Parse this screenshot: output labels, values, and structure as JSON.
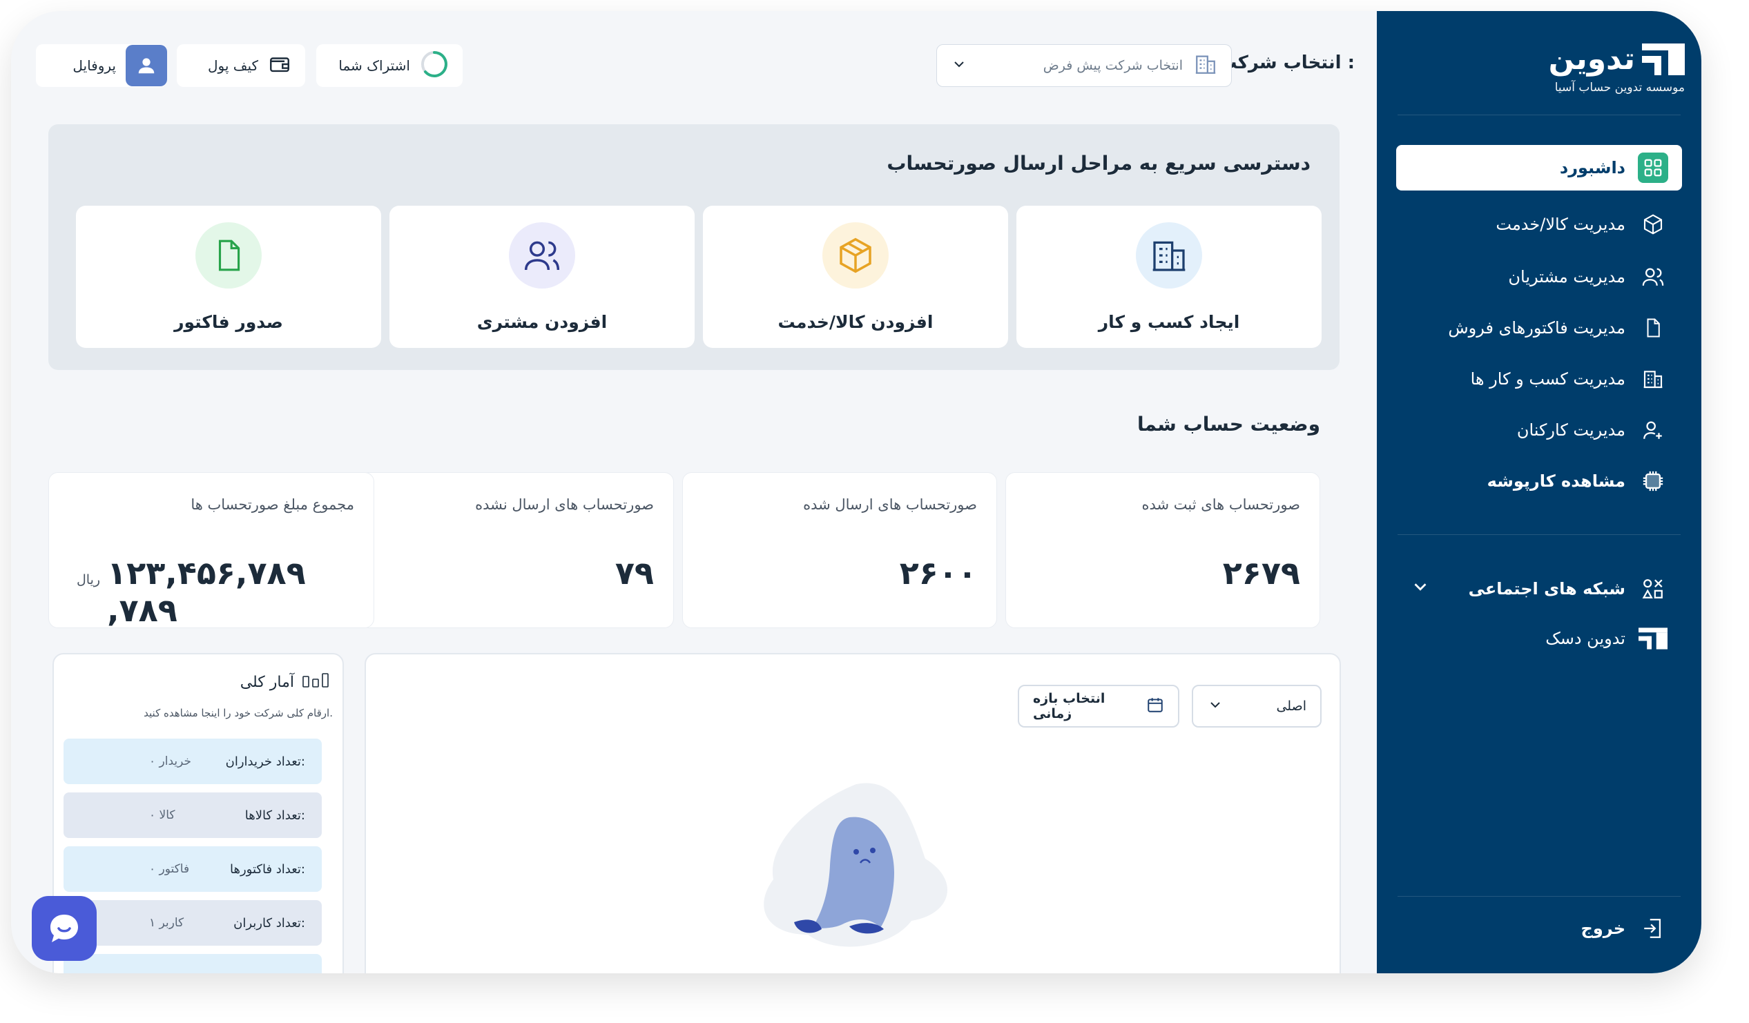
{
  "brand": {
    "name": "تدوین",
    "subtitle": "موسسه تدوین حساب آسیا"
  },
  "sidebar": {
    "items": [
      {
        "label": "داشبورد",
        "icon": "grid-icon"
      },
      {
        "label": "مدیریت کالا/خدمت",
        "icon": "box-icon"
      },
      {
        "label": "مدیریت مشتریان",
        "icon": "users-icon"
      },
      {
        "label": "مدیریت فاکتورهای فروش",
        "icon": "document-icon"
      },
      {
        "label": "مدیریت کسب و کار ها",
        "icon": "building-icon"
      },
      {
        "label": "مدیریت کارکنان",
        "icon": "user-plus-icon"
      },
      {
        "label": "مشاهده کارپوشه",
        "icon": "chip-icon"
      },
      {
        "label": "شبکه های اجتماعی",
        "icon": "shapes-icon"
      },
      {
        "label": "تدوین دسک",
        "icon": "tadvin-desk-icon"
      }
    ],
    "logout": "خروج"
  },
  "topbar": {
    "company_label": "انتخاب شرکت :",
    "company_placeholder": "انتخاب شرکت پیش فرض",
    "subscription": "اشتراک شما",
    "wallet": "کیف پول",
    "profile": "پروفایل"
  },
  "quick": {
    "title": "دسترسی سریع به مراحل ارسال صورتحساب",
    "cards": [
      {
        "label": "ایجاد کسب و کار",
        "icon": "building-icon",
        "color": "#e3f0fb"
      },
      {
        "label": "افزودن کالا/خدمت",
        "icon": "box-icon",
        "color": "#fdf3dc"
      },
      {
        "label": "افزودن مشتری",
        "icon": "users-icon",
        "color": "#ebebfb"
      },
      {
        "label": "صدور فاکتور",
        "icon": "document-icon",
        "color": "#e3f7e8"
      }
    ]
  },
  "status": {
    "title": "وضعیت حساب شما",
    "cards": [
      {
        "title": "صورتحساب های ثبت شده",
        "value": "۲۶۷۹"
      },
      {
        "title": "صورتحساب های ارسال شده",
        "value": "۲۶۰۰"
      },
      {
        "title": "صورتحساب های ارسال نشده",
        "value": "۷۹"
      },
      {
        "title": "مجموع مبلغ صورتحساب ها",
        "value": "۱۲۳,۴۵۶,۷۸۹ ,۷۸۹",
        "unit": "ریال"
      }
    ]
  },
  "chart_panel": {
    "series_select": "اصلی",
    "range_button": "انتخاب بازه زمانی"
  },
  "stats": {
    "title": "آمار کلی",
    "subtitle": "ارقام کلی شرکت خود را اینجا مشاهده کنید.",
    "rows": [
      {
        "label": "تعداد خریداران:",
        "value": "۰ خریدار"
      },
      {
        "label": "تعداد کالاها:",
        "value": "۰ کالا"
      },
      {
        "label": "تعداد فاکتورها:",
        "value": "۰ فاکتور"
      },
      {
        "label": "تعداد کاربران:",
        "value": "۱ کاربر"
      }
    ]
  },
  "colors": {
    "sidebar": "#003d6b",
    "accent": "#2cb088",
    "primary": "#4a5bd8"
  }
}
